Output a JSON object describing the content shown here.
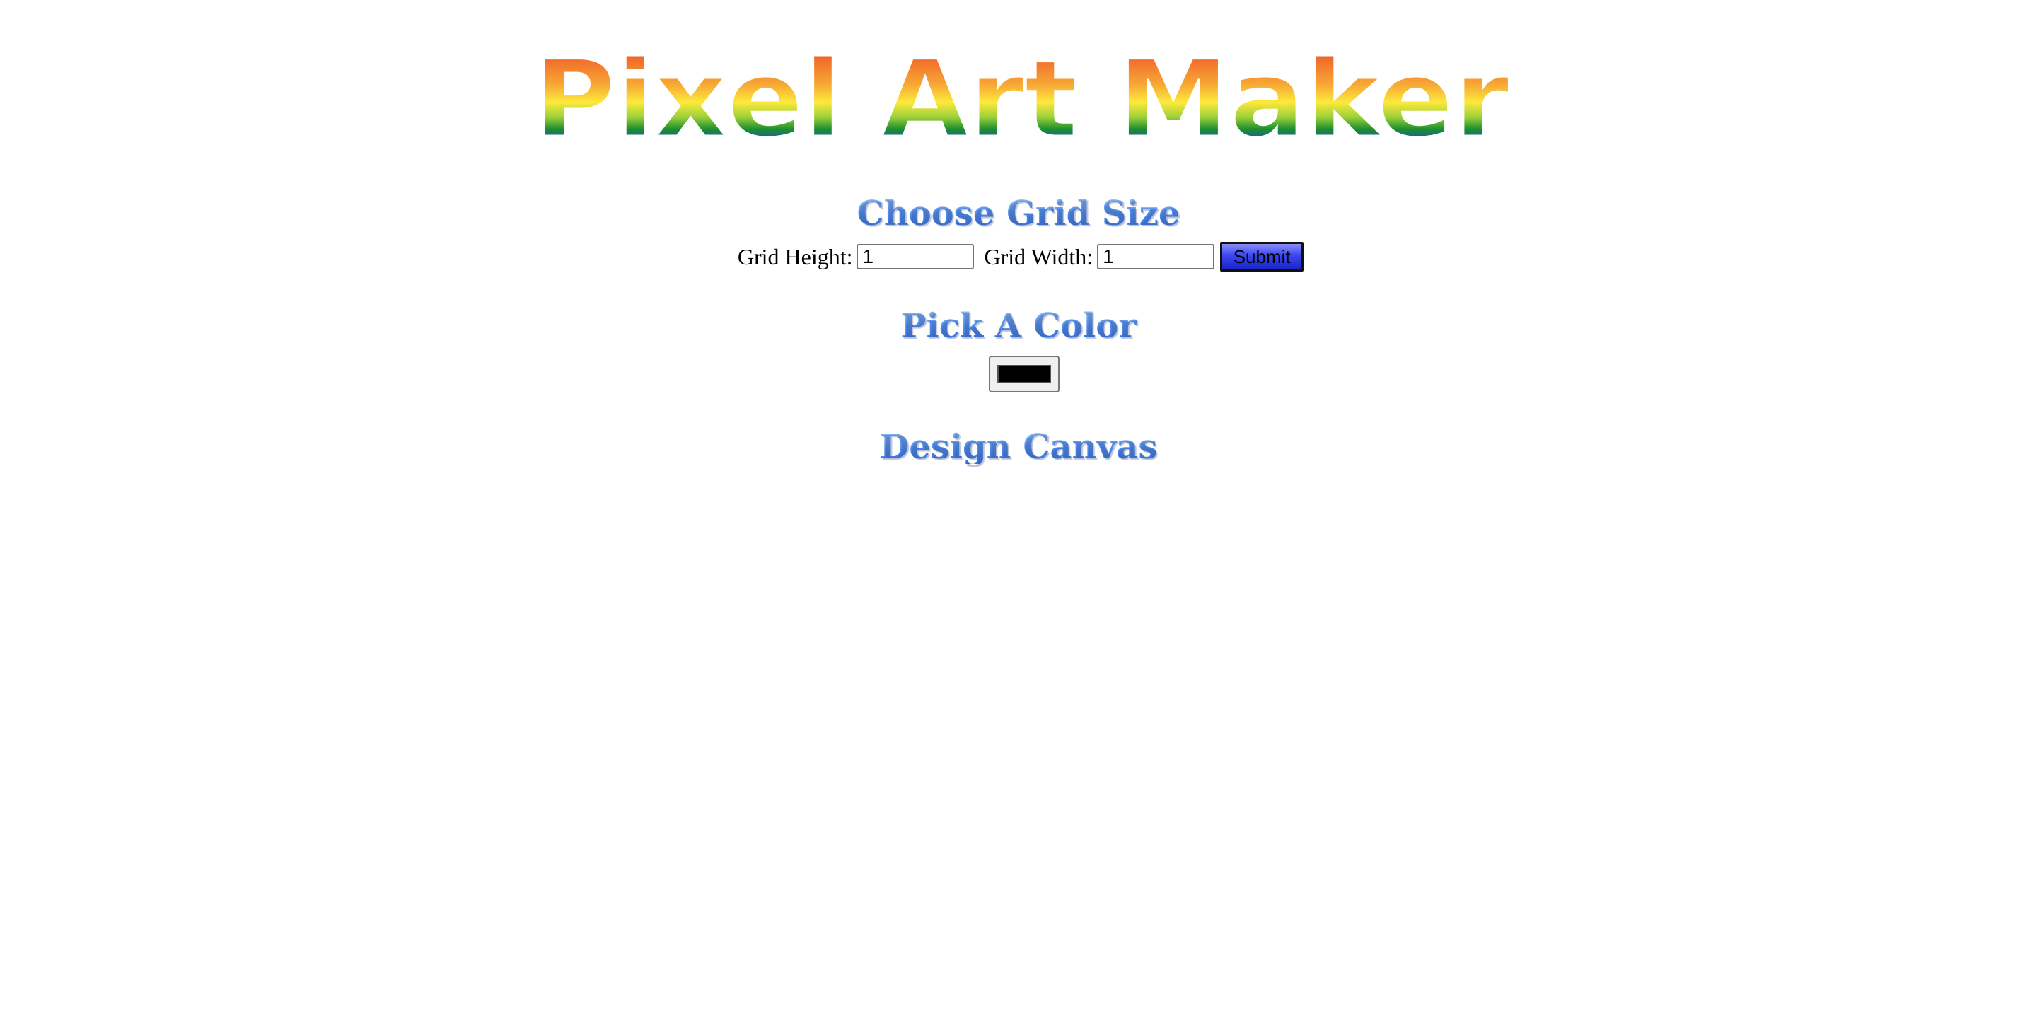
{
  "header": {
    "logo_text": "Pixel Art Maker"
  },
  "grid_size": {
    "title": "Choose Grid Size",
    "height_label": "Grid Height:",
    "height_value": "1",
    "width_label": "Grid Width:",
    "width_value": "1",
    "submit_label": "Submit"
  },
  "color": {
    "title": "Pick A Color",
    "value": "#000000"
  },
  "canvas": {
    "title": "Design Canvas"
  },
  "colors": {
    "heading": "#4a8fec",
    "submit_button": "#3a47f0"
  }
}
